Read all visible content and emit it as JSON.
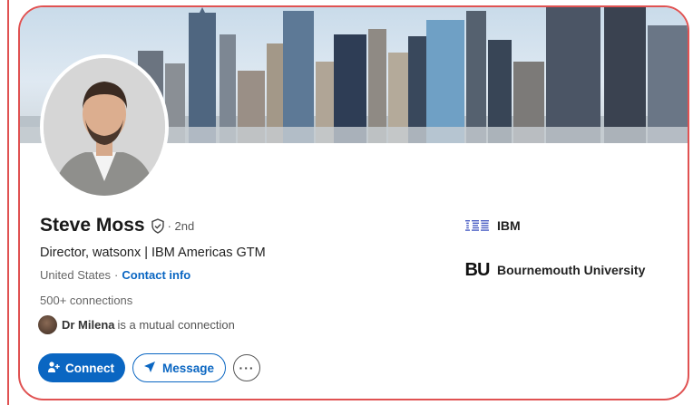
{
  "profile": {
    "name": "Steve Moss",
    "degree": "· 2nd",
    "headline": "Director, watsonx | IBM Americas GTM",
    "location": "United States",
    "contact_label": "Contact info",
    "connections": "500+ connections",
    "mutual": {
      "name": "Dr Milena",
      "rest": "is a mutual connection"
    }
  },
  "actions": {
    "connect_label": "Connect",
    "message_label": "Message",
    "more_label": "···"
  },
  "organizations": [
    {
      "name": "IBM",
      "logo": "IBM"
    },
    {
      "name": "Bournemouth University",
      "logo": "BU"
    }
  ],
  "icons": {
    "verify": "shield-check-icon",
    "connect": "add-user-icon",
    "message": "send-icon",
    "more": "ellipsis-icon"
  },
  "colors": {
    "accent": "#0a66c2",
    "border": "#e05252",
    "text": "#191919"
  }
}
